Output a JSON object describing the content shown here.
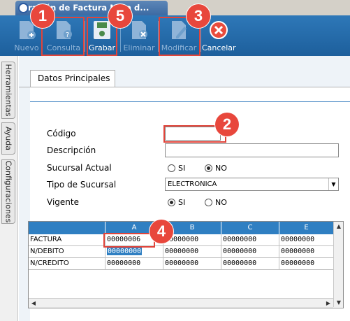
{
  "window": {
    "title": "ración de Factura Nota d..."
  },
  "toolbar": {
    "nuevo": "Nuevo",
    "consulta": "Consulta",
    "grabar": "Grabar",
    "eliminar": "Eliminar",
    "modificar": "Modificar",
    "cancelar": "Cancelar"
  },
  "sidebar": {
    "tabs": [
      "Herramientas",
      "Ayuda",
      "Configuraciones"
    ]
  },
  "form": {
    "tab_title": "Datos Principales",
    "codigo_label": "Código",
    "codigo_value": "",
    "descripcion_label": "Descripción",
    "descripcion_value": "",
    "sucursal_actual_label": "Sucursal Actual",
    "si": "SI",
    "no": "NO",
    "sucursal_actual_selected": "NO",
    "tipo_sucursal_label": "Tipo de Sucursal",
    "tipo_sucursal_value": "ELECTRONICA",
    "vigente_label": "Vigente",
    "vigente_selected": "SI"
  },
  "grid": {
    "columns": [
      "A",
      "B",
      "C",
      "E"
    ],
    "rows": [
      {
        "label": "FACTURA",
        "cells": [
          "00000006",
          "00000000",
          "00000000",
          "00000000"
        ]
      },
      {
        "label": "N/DEBITO",
        "cells": [
          "00000000",
          "00000000",
          "00000000",
          "00000000"
        ]
      },
      {
        "label": "N/CREDITO",
        "cells": [
          "00000000",
          "00000000",
          "00000000",
          "00000000"
        ]
      }
    ],
    "selected_cell": "N/DEBITO:A"
  },
  "annotations": [
    "1",
    "2",
    "3",
    "4",
    "5"
  ],
  "colors": {
    "toolbar": "#2e78b8",
    "accent": "#2f7fc2",
    "annotation": "#e8473c"
  }
}
